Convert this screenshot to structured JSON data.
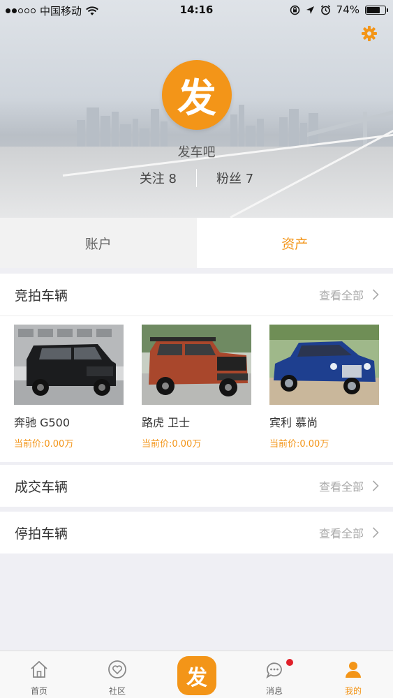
{
  "status_bar": {
    "carrier": "中国移动",
    "time": "14:16",
    "battery": "74%",
    "battery_level": 0.74
  },
  "profile": {
    "avatar_text": "发",
    "nickname": "发车吧",
    "follow_label": "关注 8",
    "fans_label": "粉丝 7"
  },
  "tabs": {
    "account": "账户",
    "assets": "资产"
  },
  "sections": {
    "bidding": {
      "title": "竞拍车辆",
      "more": "查看全部",
      "cars": [
        {
          "name": "奔驰 G500",
          "price": "当前价:0.00万"
        },
        {
          "name": "路虎 卫士",
          "price": "当前价:0.00万"
        },
        {
          "name": "宾利 慕尚",
          "price": "当前价:0.00万"
        }
      ]
    },
    "deals": {
      "title": "成交车辆",
      "more": "查看全部"
    },
    "stopped": {
      "title": "停拍车辆",
      "more": "查看全部"
    }
  },
  "tabbar": {
    "home": "首页",
    "community": "社区",
    "center": "发",
    "messages": "消息",
    "mine": "我的"
  },
  "colors": {
    "accent": "#f39518",
    "badge": "#e0202a"
  }
}
